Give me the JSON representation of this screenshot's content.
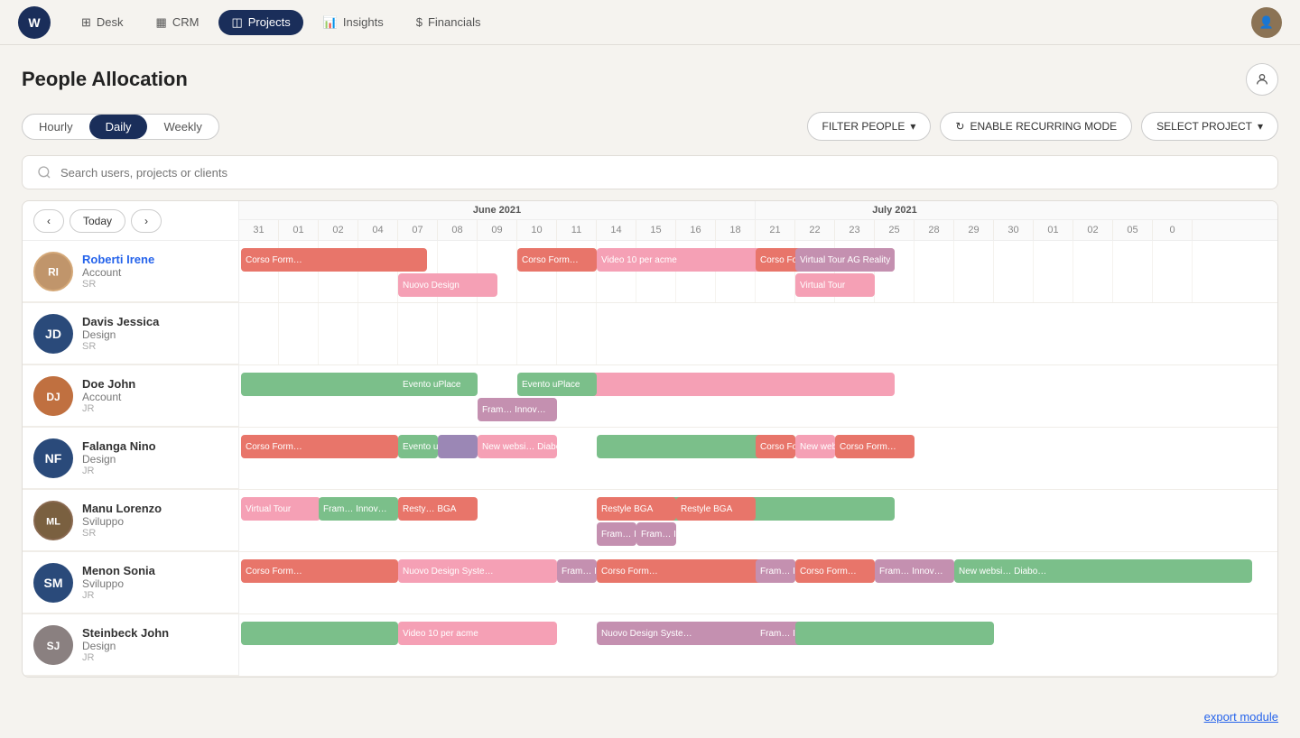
{
  "app": {
    "logo": "W"
  },
  "nav": {
    "items": [
      {
        "id": "desk",
        "label": "Desk",
        "icon": "⊞",
        "active": false
      },
      {
        "id": "crm",
        "label": "CRM",
        "icon": "▦",
        "active": false
      },
      {
        "id": "projects",
        "label": "Projects",
        "icon": "◫",
        "active": true
      },
      {
        "id": "insights",
        "label": "Insights",
        "icon": "📊",
        "active": false
      },
      {
        "id": "financials",
        "label": "Financials",
        "icon": "$",
        "active": false
      }
    ]
  },
  "page": {
    "title": "People Allocation",
    "search_placeholder": "Search users, projects or clients"
  },
  "view_toggle": {
    "options": [
      "Hourly",
      "Daily",
      "Weekly"
    ],
    "active": "Daily"
  },
  "toolbar": {
    "filter_people": "FILTER PEOPLE",
    "enable_recurring": "ENABLE RECURRING MODE",
    "select_project": "SELECT PROJECT"
  },
  "calendar": {
    "today_label": "Today",
    "months": [
      {
        "label": "June 2021",
        "dates": [
          "31",
          "01",
          "02",
          "04",
          "07",
          "08",
          "09",
          "10",
          "11",
          "14",
          "15",
          "16",
          "18",
          "21",
          "22",
          "23",
          "25"
        ]
      },
      {
        "label": "July 2021",
        "dates": [
          "28",
          "29",
          "30",
          "01",
          "02",
          "05",
          "0"
        ]
      }
    ]
  },
  "people": [
    {
      "id": "roberti-irene",
      "name": "Roberti Irene",
      "dept": "Account",
      "role": "SR",
      "avatar_type": "image",
      "avatar_color": "#c0956b",
      "initials": "RI",
      "name_color": "blue"
    },
    {
      "id": "davis-jessica",
      "name": "Davis Jessica",
      "dept": "Design",
      "role": "SR",
      "avatar_type": "initials",
      "avatar_color": "#2a4a7a",
      "initials": "JD",
      "name_color": ""
    },
    {
      "id": "doe-john",
      "name": "Doe John",
      "dept": "Account",
      "role": "JR",
      "avatar_type": "image",
      "avatar_color": "#c07040",
      "initials": "DJ",
      "name_color": ""
    },
    {
      "id": "falanga-nino",
      "name": "Falanga Nino",
      "dept": "Design",
      "role": "JR",
      "avatar_type": "initials",
      "avatar_color": "#2a4a7a",
      "initials": "NF",
      "name_color": ""
    },
    {
      "id": "manu-lorenzo",
      "name": "Manu Lorenzo",
      "dept": "Sviluppo",
      "role": "SR",
      "avatar_type": "image",
      "avatar_color": "#7a6040",
      "initials": "ML",
      "name_color": ""
    },
    {
      "id": "menon-sonia",
      "name": "Menon Sonia",
      "dept": "Sviluppo",
      "role": "JR",
      "avatar_type": "initials",
      "avatar_color": "#2a4a7a",
      "initials": "SM",
      "name_color": ""
    },
    {
      "id": "steinbeck-john",
      "name": "Steinbeck John",
      "dept": "Design",
      "role": "JR",
      "avatar_type": "image",
      "avatar_color": "#8a8a8a",
      "initials": "SJ",
      "name_color": ""
    }
  ],
  "footer": {
    "export_label": "export module"
  }
}
